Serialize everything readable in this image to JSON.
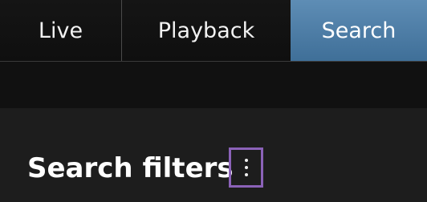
{
  "tabs": [
    {
      "label": "Live"
    },
    {
      "label": "Playback"
    },
    {
      "label": "Search",
      "active": true
    }
  ],
  "search_panel": {
    "title": "Search filters",
    "menu_icon": "more-vertical-icon"
  },
  "colors": {
    "active_tab": "#4f7ea8",
    "highlight_border": "#8b62b8"
  }
}
